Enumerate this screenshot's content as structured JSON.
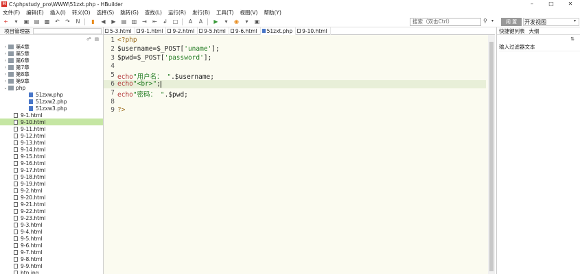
{
  "window": {
    "app_icon": "H",
    "title": "C:\\phpstudy_pro\\WWW\\51zxt.php  -  HBuilder",
    "controls": [
      "–",
      "□",
      "✕"
    ]
  },
  "menu": [
    "文件(F)",
    "编辑(E)",
    "插入(I)",
    "转义(O)",
    "选择(S)",
    "跳转(G)",
    "查找(L)",
    "运行(R)",
    "发行(B)",
    "工具(T)",
    "视图(V)",
    "帮助(Y)"
  ],
  "toolbar": {
    "search_placeholder": "搜索（双击Ctrl）",
    "view_toggle": "闲 置",
    "view_label": "开发视图"
  },
  "sidebar": {
    "title": "项目管理器",
    "items": [
      {
        "label": "第4章",
        "level": 0,
        "type": "folder",
        "twisty": ">"
      },
      {
        "label": "第5章",
        "level": 0,
        "type": "folder",
        "twisty": ">"
      },
      {
        "label": "第6章",
        "level": 0,
        "type": "folder",
        "twisty": ">"
      },
      {
        "label": "第7章",
        "level": 0,
        "type": "folder",
        "twisty": ">"
      },
      {
        "label": "第8章",
        "level": 0,
        "type": "folder",
        "twisty": ">"
      },
      {
        "label": "第9章",
        "level": 0,
        "type": "folder",
        "twisty": ">"
      },
      {
        "label": "php",
        "level": 0,
        "type": "folder",
        "twisty": "v"
      },
      {
        "label": "51zxw.php",
        "level": 1,
        "type": "php"
      },
      {
        "label": "51zxw2.php",
        "level": 1,
        "type": "php"
      },
      {
        "label": "51zxw3.php",
        "level": 1,
        "type": "php"
      },
      {
        "label": "9-1.html",
        "level": 0,
        "type": "file"
      },
      {
        "label": "9-10.html",
        "level": 0,
        "type": "file",
        "selected": true
      },
      {
        "label": "9-11.html",
        "level": 0,
        "type": "file"
      },
      {
        "label": "9-12.html",
        "level": 0,
        "type": "file"
      },
      {
        "label": "9-13.html",
        "level": 0,
        "type": "file"
      },
      {
        "label": "9-14.html",
        "level": 0,
        "type": "file"
      },
      {
        "label": "9-15.html",
        "level": 0,
        "type": "file"
      },
      {
        "label": "9-16.html",
        "level": 0,
        "type": "file"
      },
      {
        "label": "9-17.html",
        "level": 0,
        "type": "file"
      },
      {
        "label": "9-18.html",
        "level": 0,
        "type": "file"
      },
      {
        "label": "9-19.html",
        "level": 0,
        "type": "file"
      },
      {
        "label": "9-2.html",
        "level": 0,
        "type": "file"
      },
      {
        "label": "9-20.html",
        "level": 0,
        "type": "file"
      },
      {
        "label": "9-21.html",
        "level": 0,
        "type": "file"
      },
      {
        "label": "9-22.html",
        "level": 0,
        "type": "file"
      },
      {
        "label": "9-23.html",
        "level": 0,
        "type": "file"
      },
      {
        "label": "9-3.html",
        "level": 0,
        "type": "file"
      },
      {
        "label": "9-4.html",
        "level": 0,
        "type": "file"
      },
      {
        "label": "9-5.html",
        "level": 0,
        "type": "file"
      },
      {
        "label": "9-6.html",
        "level": 0,
        "type": "file"
      },
      {
        "label": "9-7.html",
        "level": 0,
        "type": "file"
      },
      {
        "label": "9-8.html",
        "level": 0,
        "type": "file"
      },
      {
        "label": "9-9.html",
        "level": 0,
        "type": "file"
      },
      {
        "label": "btn.jpg",
        "level": 0,
        "type": "file"
      }
    ]
  },
  "tabs": [
    {
      "label": "5-3.html",
      "type": "file"
    },
    {
      "label": "9-1.html",
      "type": "file"
    },
    {
      "label": "9-2.html",
      "type": "file"
    },
    {
      "label": "9-5.html",
      "type": "file"
    },
    {
      "label": "9-6.html",
      "type": "file"
    },
    {
      "label": "51zxt.php",
      "type": "php",
      "active": true
    },
    {
      "label": "9-10.html",
      "type": "file"
    }
  ],
  "editor": {
    "lines": [
      {
        "n": "1",
        "segments": [
          {
            "t": "<?php",
            "c": "tag"
          }
        ]
      },
      {
        "n": "2",
        "segments": [
          {
            "t": "$username=$_POST[",
            "c": ""
          },
          {
            "t": "'uname'",
            "c": "str"
          },
          {
            "t": "];",
            "c": ""
          }
        ]
      },
      {
        "n": "3",
        "segments": [
          {
            "t": "$pwd=$_POST[",
            "c": ""
          },
          {
            "t": "'password'",
            "c": "str"
          },
          {
            "t": "];",
            "c": ""
          }
        ]
      },
      {
        "n": "4",
        "segments": []
      },
      {
        "n": "5",
        "segments": [
          {
            "t": "echo",
            "c": "kw"
          },
          {
            "t": "\"用户名： \"",
            "c": "str"
          },
          {
            "t": ".$username;",
            "c": ""
          }
        ]
      },
      {
        "n": "6",
        "segments": [
          {
            "t": "echo",
            "c": "kw"
          },
          {
            "t": "\"<br>\"",
            "c": "str"
          },
          {
            "t": ";",
            "c": ""
          }
        ],
        "cursor": true
      },
      {
        "n": "7",
        "segments": [
          {
            "t": "echo",
            "c": "kw"
          },
          {
            "t": "\"密码： \"",
            "c": "str"
          },
          {
            "t": ".$pwd;",
            "c": ""
          }
        ]
      },
      {
        "n": "8",
        "segments": []
      },
      {
        "n": "9",
        "segments": [
          {
            "t": "?>",
            "c": "tag"
          }
        ]
      }
    ]
  },
  "right_panel": {
    "tabs": [
      "快捷键列表",
      "大纲"
    ],
    "filter_label": "输入过滤器文本",
    "sort_icon": "⇅"
  }
}
